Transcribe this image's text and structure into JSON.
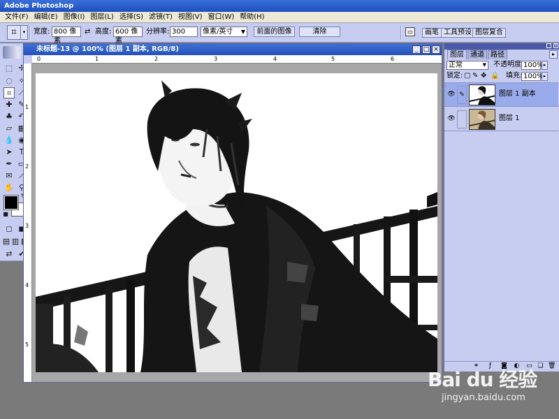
{
  "app": {
    "title": "Adobe Photoshop"
  },
  "menu": {
    "items": [
      "文件(F)",
      "编辑(E)",
      "图像(I)",
      "图层(L)",
      "选择(S)",
      "滤镜(T)",
      "视图(V)",
      "窗口(W)",
      "帮助(H)"
    ]
  },
  "options": {
    "width_label": "宽度:",
    "width_value": "800 像素",
    "swap_icon": "⇄",
    "height_label": "高度:",
    "height_value": "600 像素",
    "resolution_label": "分辨率:",
    "resolution_value": "300",
    "units_value": "像素/英寸",
    "front_image_label": "前面的图像",
    "clear_label": "清除"
  },
  "palette_well": {
    "tabs": [
      "画笔",
      "工具预设",
      "图层复合"
    ]
  },
  "document": {
    "title": "未标题-13 @ 100% (图层 1 副本, RGB/8)",
    "ruler_h": [
      "0",
      "1",
      "2",
      "3",
      "4",
      "5",
      "6"
    ],
    "ruler_v": [
      "1",
      "2",
      "3",
      "4",
      "5"
    ],
    "minimize": "_",
    "maximize": "□",
    "close": "×"
  },
  "layers_panel": {
    "tabs": [
      "图层",
      "通道",
      "路径"
    ],
    "blend_mode": "正常",
    "opacity_label": "不透明度:",
    "opacity_value": "100%",
    "lock_label": "锁定:",
    "fill_label": "填充:",
    "fill_value": "100%",
    "layers": [
      {
        "name": "图层 1 副本",
        "selected": true
      },
      {
        "name": "图层 1",
        "selected": false
      }
    ]
  },
  "watermark": {
    "logo": "Bai du 经验",
    "url": "jingyan.baidu.com"
  },
  "colors": {
    "title_bar": "#2452b8",
    "panel_bg": "#c7cdf0",
    "workspace": "#7a7a7a",
    "selected_layer": "#9aabeb"
  }
}
